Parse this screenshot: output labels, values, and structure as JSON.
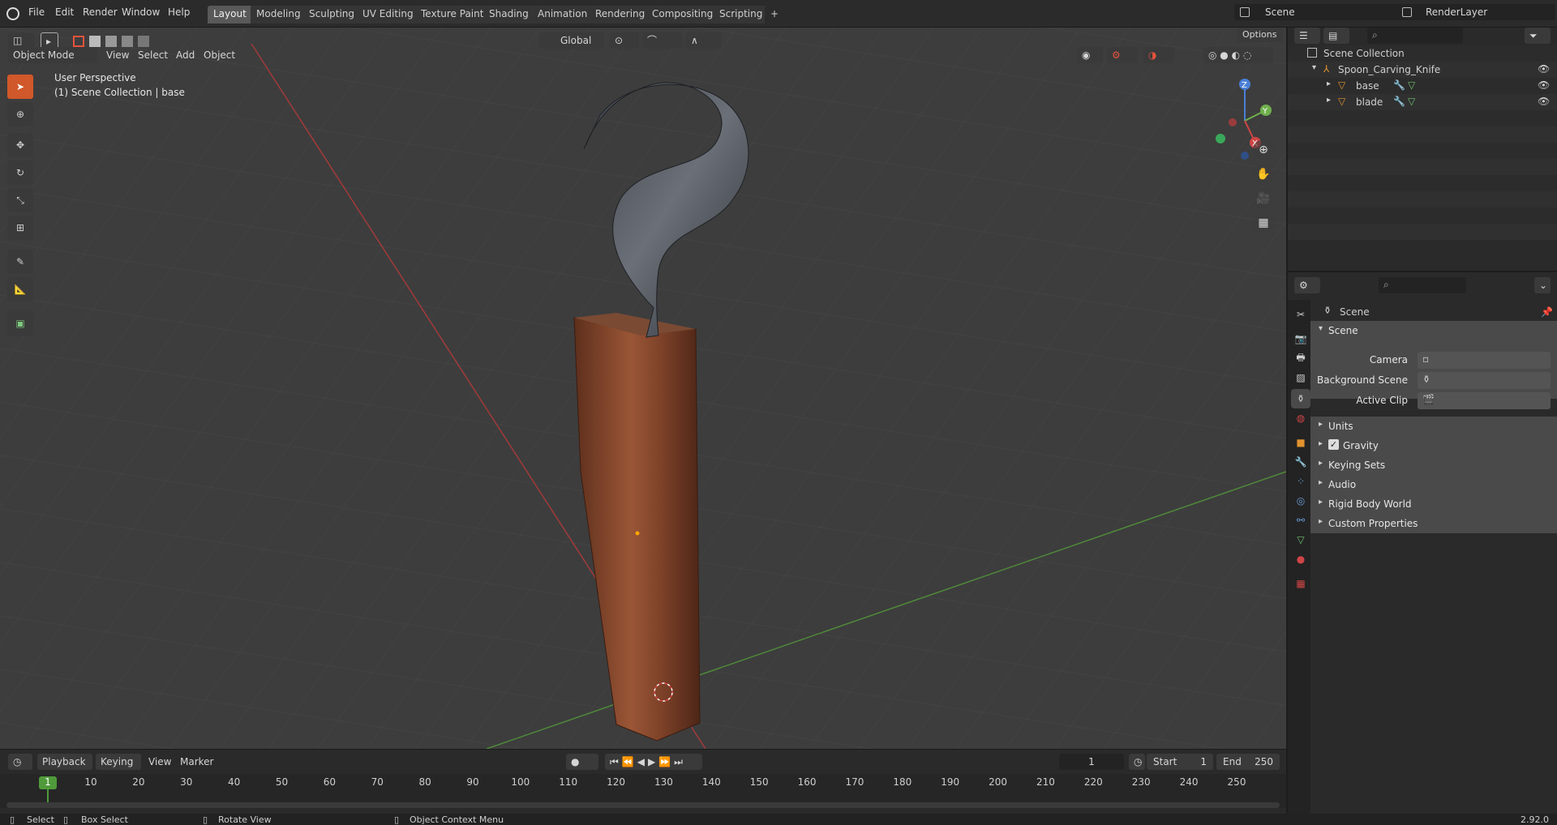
{
  "topbar": {
    "menus": [
      "File",
      "Edit",
      "Render",
      "Window",
      "Help"
    ],
    "workspaces": [
      "Layout",
      "Modeling",
      "Sculpting",
      "UV Editing",
      "Texture Paint",
      "Shading",
      "Animation",
      "Rendering",
      "Compositing",
      "Scripting"
    ],
    "active_workspace": "Layout",
    "add_tab": "+",
    "scene_name": "Scene",
    "view_layer": "RenderLayer"
  },
  "viewport_header": {
    "mode": "Object Mode",
    "menus": [
      "View",
      "Select",
      "Add",
      "Object"
    ],
    "orientation": "Global",
    "options": "Options"
  },
  "viewport": {
    "perspective": "User Perspective",
    "collection_info": "(1) Scene Collection | base",
    "gizmo_axes": [
      "Z",
      "Y",
      "X"
    ]
  },
  "outliner": {
    "root": "Scene Collection",
    "collection": "Spoon_Carving_Knife",
    "objects": [
      "base",
      "blade"
    ]
  },
  "properties": {
    "header": "Scene",
    "panel": "Scene",
    "fields": [
      "Camera",
      "Background Scene",
      "Active Clip"
    ],
    "subpanels": [
      "Units",
      "Gravity",
      "Keying Sets",
      "Audio",
      "Rigid Body World",
      "Custom Properties"
    ],
    "gravity_checked": true
  },
  "timeline": {
    "menus": [
      "Playback",
      "Keying",
      "View",
      "Marker"
    ],
    "current_frame": "1",
    "start_label": "Start",
    "start_value": "1",
    "end_label": "End",
    "end_value": "250",
    "ticks": [
      "1",
      "10",
      "20",
      "30",
      "40",
      "50",
      "60",
      "70",
      "80",
      "90",
      "100",
      "110",
      "120",
      "130",
      "140",
      "150",
      "160",
      "170",
      "180",
      "190",
      "200",
      "210",
      "220",
      "230",
      "240",
      "250"
    ]
  },
  "statusbar": {
    "items": [
      "Select",
      "Box Select",
      "Rotate View",
      "Object Context Menu"
    ],
    "version": "2.92.0"
  },
  "colors": {
    "accent": "#d0582a",
    "active_tab": "#595959",
    "viewport_bg": "#3d3d3d"
  }
}
